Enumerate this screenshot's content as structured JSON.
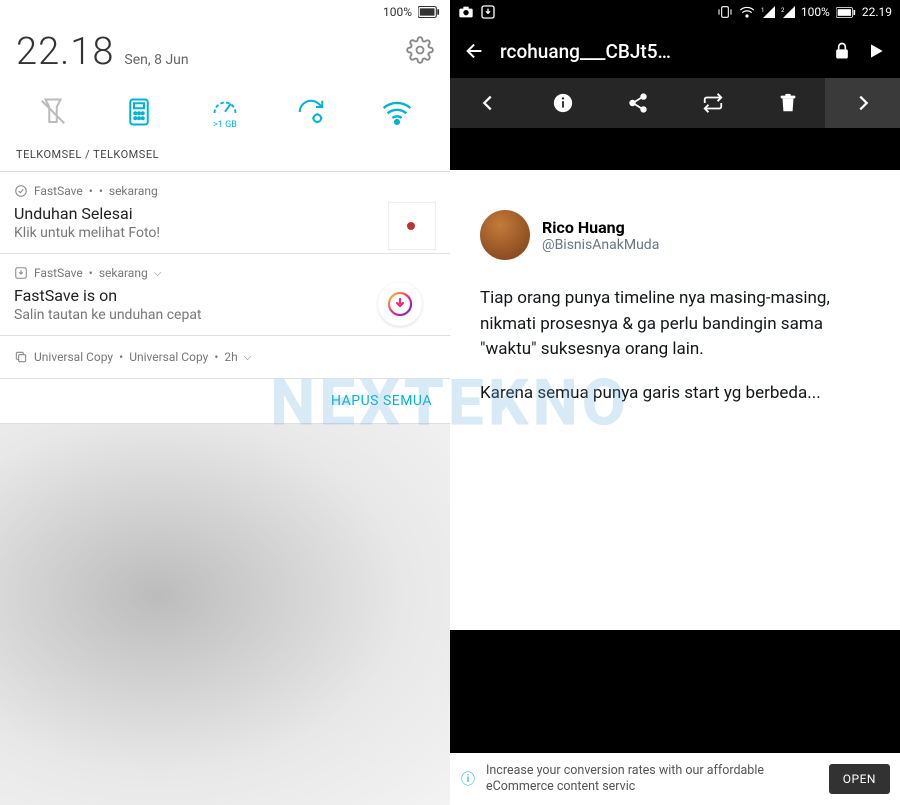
{
  "left": {
    "status": {
      "battery_pct": "100%"
    },
    "time": "22.18",
    "date": "Sen, 8 Jun",
    "quick": {
      "data_label": ">1 GB"
    },
    "carrier": "TELKOMSEL / TELKOMSEL",
    "notif1": {
      "app": "FastSave",
      "dot": "•",
      "when": "sekarang",
      "title": "Unduhan Selesai",
      "subtitle": "Klik untuk melihat Foto!"
    },
    "notif2": {
      "app": "FastSave",
      "dot": "•",
      "when": "sekarang",
      "chev": "⌵",
      "title": "FastSave is on",
      "subtitle": "Salin tautan ke unduhan cepat"
    },
    "notif3": {
      "app": "Universal Copy",
      "dot": "•",
      "sub": "Universal Copy",
      "dot2": "•",
      "when": "2h",
      "chev": "⌵"
    },
    "clear_all": "HAPUS SEMUA"
  },
  "watermark": "NEXTEKNO",
  "right": {
    "status": {
      "battery_pct": "100%",
      "clock": "22.19"
    },
    "appbar": {
      "title": "rcohuang___CBJt5…"
    },
    "tweet": {
      "name": "Rico Huang",
      "handle": "@BisnisAnakMuda",
      "p1": "Tiap orang punya timeline nya masing-masing, nikmati prosesnya & ga perlu bandingin sama \"waktu\" suksesnya orang lain.",
      "p2": "Karena semua punya garis start yg berbeda..."
    },
    "ad": {
      "text": "Increase your conversion rates with our affordable eCommerce content servic",
      "button": "OPEN"
    }
  }
}
